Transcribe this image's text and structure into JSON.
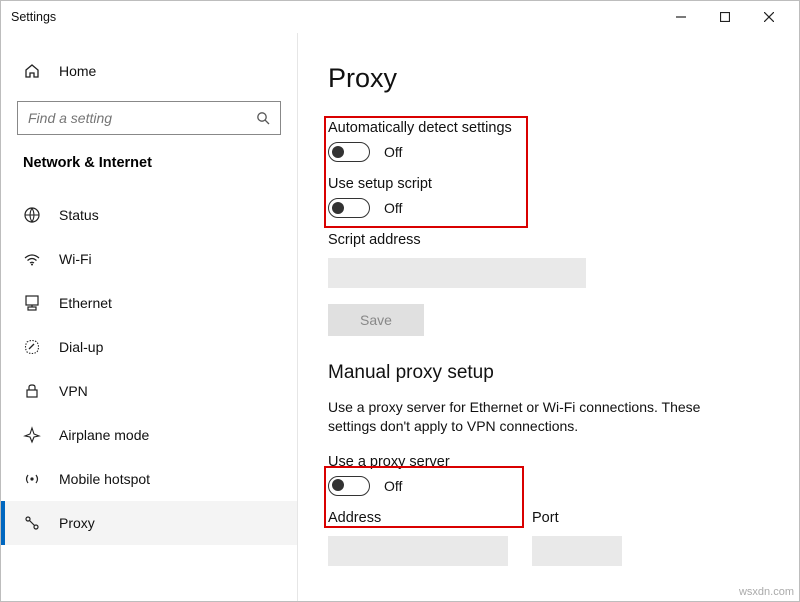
{
  "window": {
    "title": "Settings"
  },
  "sidebar": {
    "home_label": "Home",
    "search_placeholder": "Find a setting",
    "category": "Network & Internet",
    "items": [
      {
        "label": "Status"
      },
      {
        "label": "Wi-Fi"
      },
      {
        "label": "Ethernet"
      },
      {
        "label": "Dial-up"
      },
      {
        "label": "VPN"
      },
      {
        "label": "Airplane mode"
      },
      {
        "label": "Mobile hotspot"
      },
      {
        "label": "Proxy"
      }
    ]
  },
  "content": {
    "page_title": "Proxy",
    "auto_detect_label": "Automatically detect settings",
    "auto_detect_state": "Off",
    "use_script_label": "Use setup script",
    "use_script_state": "Off",
    "script_address_label": "Script address",
    "save_label": "Save",
    "manual_section_title": "Manual proxy setup",
    "manual_desc": "Use a proxy server for Ethernet or Wi-Fi connections. These settings don't apply to VPN connections.",
    "use_proxy_label": "Use a proxy server",
    "use_proxy_state": "Off",
    "address_label": "Address",
    "port_label": "Port"
  },
  "watermark": "wsxdn.com"
}
